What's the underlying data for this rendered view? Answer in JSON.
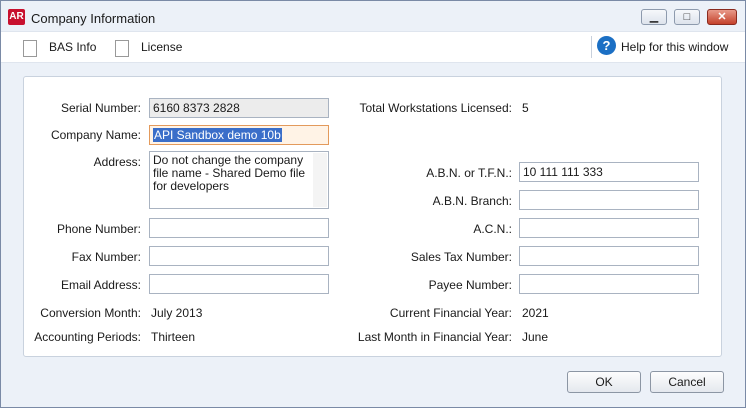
{
  "window": {
    "title": "Company Information",
    "app_icon": "AR"
  },
  "toolbar": {
    "bas_info": "BAS Info",
    "license": "License",
    "help": "Help for this window"
  },
  "form": {
    "serial_number": {
      "label": "Serial Number:",
      "value": "6160 8373 2828"
    },
    "company_name": {
      "label": "Company Name:",
      "value": "API Sandbox demo 10b"
    },
    "address": {
      "label": "Address:",
      "value": "Do not change the company file name - Shared Demo file for developers"
    },
    "phone_number": {
      "label": "Phone Number:",
      "value": ""
    },
    "fax_number": {
      "label": "Fax Number:",
      "value": ""
    },
    "email_address": {
      "label": "Email Address:",
      "value": ""
    },
    "conversion_month": {
      "label": "Conversion Month:",
      "value": "July 2013"
    },
    "accounting_periods": {
      "label": "Accounting Periods:",
      "value": "Thirteen"
    },
    "total_workstations": {
      "label": "Total Workstations Licensed:",
      "value": "5"
    },
    "abn_tfn": {
      "label": "A.B.N. or T.F.N.:",
      "value": "10 111 111 333"
    },
    "abn_branch": {
      "label": "A.B.N. Branch:",
      "value": ""
    },
    "acn": {
      "label": "A.C.N.:",
      "value": ""
    },
    "sales_tax_number": {
      "label": "Sales Tax Number:",
      "value": ""
    },
    "payee_number": {
      "label": "Payee Number:",
      "value": ""
    },
    "current_financial_year": {
      "label": "Current Financial Year:",
      "value": "2021"
    },
    "last_month_financial_year": {
      "label": "Last Month in Financial Year:",
      "value": "June"
    }
  },
  "buttons": {
    "ok": "OK",
    "cancel": "Cancel"
  },
  "icons": {
    "minimize": "minimize-icon",
    "maximize": "maximize-icon",
    "close": "close-icon",
    "help": "help-icon"
  }
}
